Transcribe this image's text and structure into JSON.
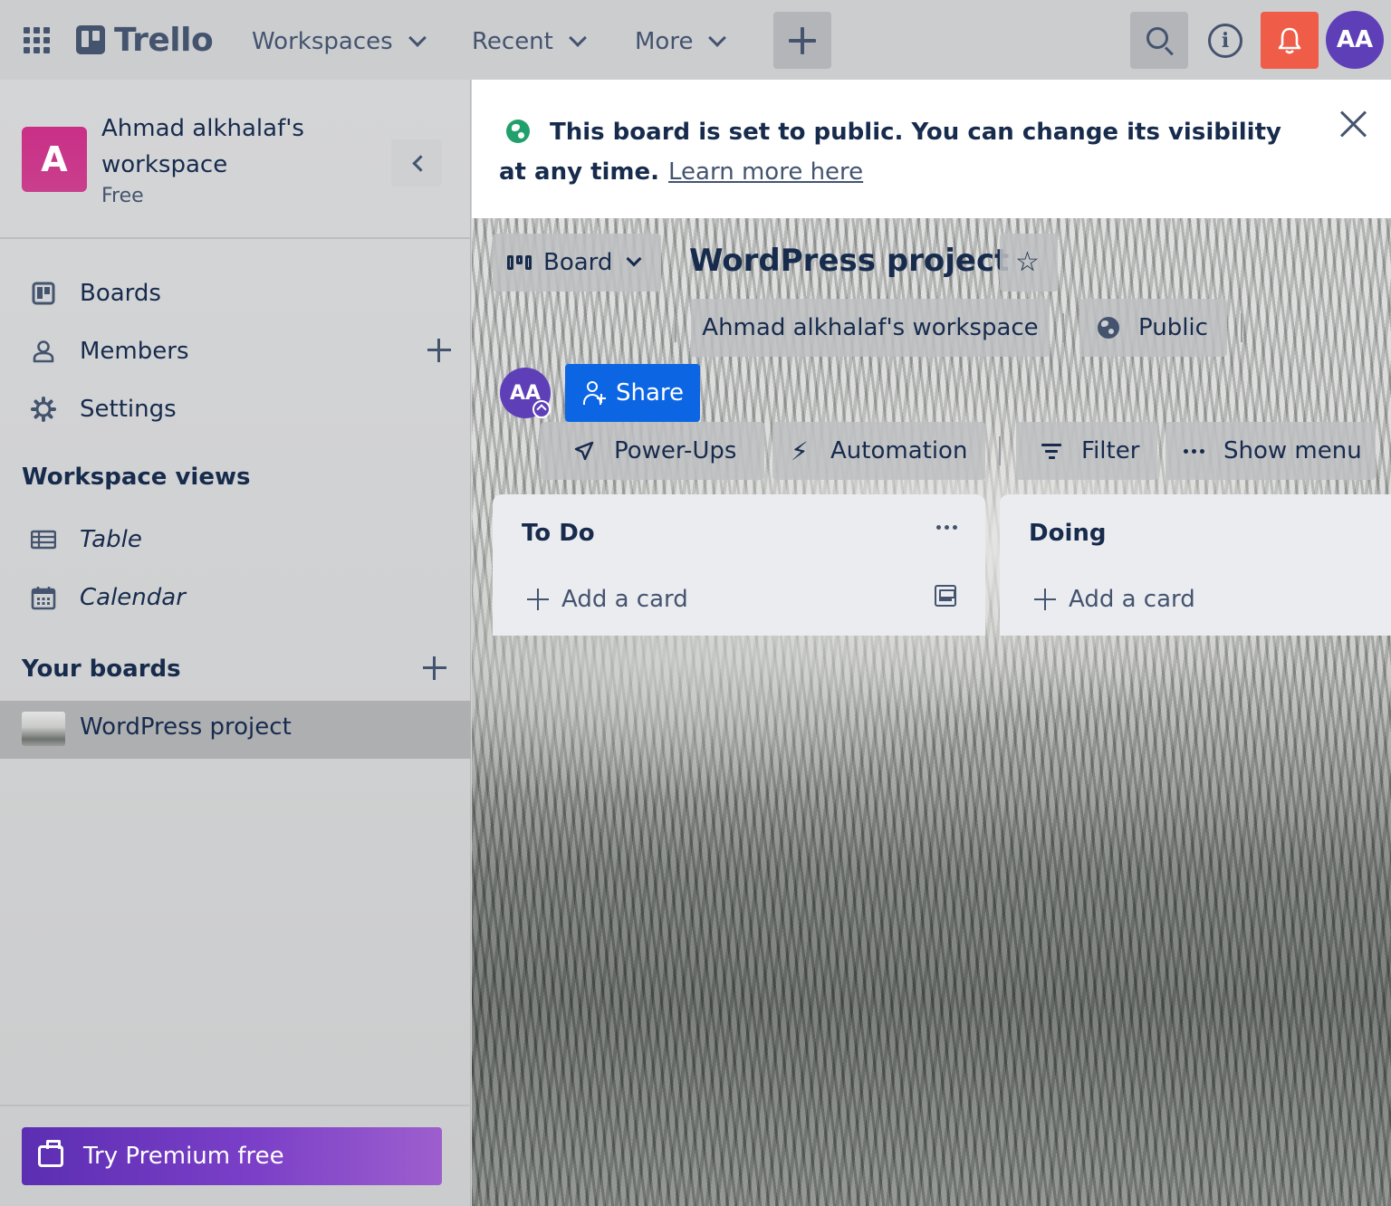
{
  "header": {
    "logo_text": "Trello",
    "nav": [
      {
        "label": "Workspaces"
      },
      {
        "label": "Recent"
      },
      {
        "label": "More"
      }
    ],
    "avatar_initials": "AA",
    "info_glyph": "i",
    "icons": [
      "app-switcher-icon",
      "trello-logo-icon",
      "plus-icon",
      "search-icon",
      "info-icon",
      "bell-icon"
    ],
    "colors": {
      "notification": "#ef5c48",
      "avatar": "#5e3fb8"
    }
  },
  "sidebar": {
    "workspace_initial": "A",
    "workspace_name": "Ahmad alkhalaf's workspace",
    "workspace_plan": "Free",
    "items": [
      {
        "label": "Boards",
        "icon": "board-icon"
      },
      {
        "label": "Members",
        "icon": "person-icon"
      },
      {
        "label": "Settings",
        "icon": "gear-icon"
      }
    ],
    "workspace_views_heading": "Workspace views",
    "views": [
      {
        "label": "Table",
        "icon": "table-icon"
      },
      {
        "label": "Calendar",
        "icon": "calendar-icon"
      }
    ],
    "your_boards_heading": "Your boards",
    "boards": [
      {
        "label": "WordPress project"
      }
    ],
    "premium_label": "Try Premium free",
    "colors": {
      "workspace_avatar": "#c92f86",
      "premium_start": "#5b2eb2",
      "premium_end": "#9d5fcd"
    }
  },
  "banner": {
    "message": "This board is set to public. You can change its visibility at any time.",
    "link": "Learn more here"
  },
  "board": {
    "view_label": "Board",
    "title": "WordPress project",
    "star_glyph": "☆",
    "workspace_label": "Ahmad alkhalaf's workspace",
    "visibility_label": "Public",
    "member_initials": "AA",
    "share_label": "Share",
    "powerups_label": "Power-Ups",
    "automation_label": "Automation",
    "automation_glyph": "⚡",
    "filter_label": "Filter",
    "show_menu_label": "Show menu",
    "colors": {
      "share": "#0c66e4",
      "list_bg": "#ebecf0"
    },
    "lists": [
      {
        "title": "To Do",
        "add_label": "Add a card"
      },
      {
        "title": "Doing",
        "add_label": "Add a card"
      }
    ]
  }
}
